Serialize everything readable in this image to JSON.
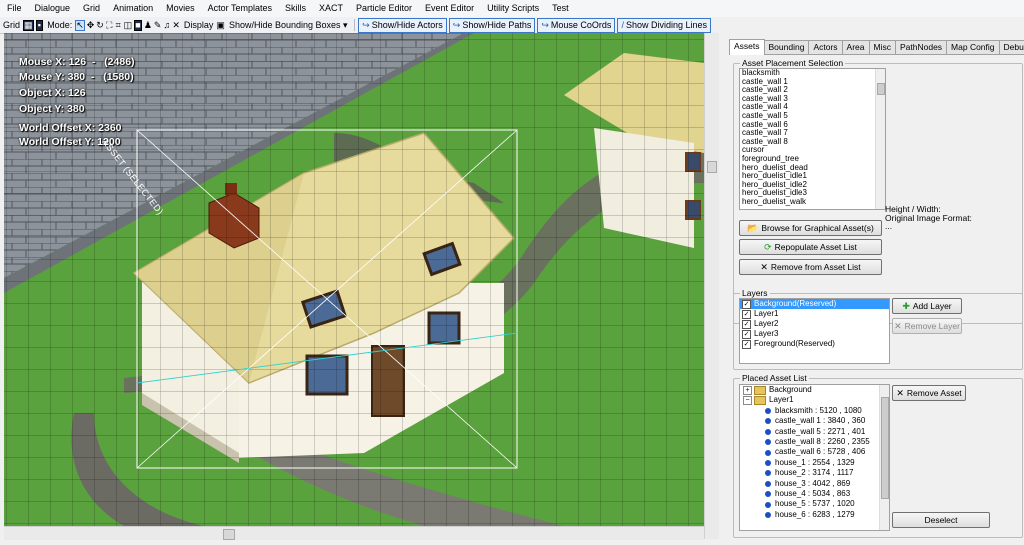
{
  "menu": [
    "File",
    "Dialogue",
    "Grid",
    "Animation",
    "Movies",
    "Actor Templates",
    "Skills",
    "XACT",
    "Particle Editor",
    "Event Editor",
    "Utility Scripts",
    "Test"
  ],
  "toolbar": {
    "grid_label": "Grid",
    "mode_label": "Mode:",
    "display_label": "Display",
    "show_bounding_boxes": "Show/Hide Bounding Boxes",
    "show_actors": "Show/Hide Actors",
    "show_paths": "Show/Hide Paths",
    "mouse_coords": "Mouse CoOrds",
    "dividing_lines": "Show Dividing Lines"
  },
  "hud": {
    "mouse_x": "Mouse X: 126  -   (2486)",
    "mouse_y": "Mouse Y: 380  -   (1580)",
    "object_x": "Object X: 126",
    "object_y": "Object Y: 380",
    "world_offset_x": "World Offset X: 2360",
    "world_offset_y": "World Offset Y: 1200",
    "selected_label": "ASSET (SELECTED)"
  },
  "tabs": [
    "Assets",
    "Bounding",
    "Actors",
    "Area",
    "Misc",
    "PathNodes",
    "Map Config",
    "Debug"
  ],
  "asset_selection": {
    "title": "Asset Placement Selection",
    "items": [
      "blacksmith",
      "castle_wall 1",
      "castle_wall 2",
      "castle_wall 3",
      "castle_wall 4",
      "castle_wall 5",
      "castle_wall 6",
      "castle_wall 7",
      "castle_wall 8",
      "cursor",
      "foreground_tree",
      "hero_duelist_dead",
      "hero_duelist_idle1",
      "hero_duelist_idle2",
      "hero_duelist_idle3",
      "hero_duelist_walk"
    ],
    "height_width": "Height / Width:",
    "original_format": "Original Image Format:",
    "ellipsis": "...",
    "browse_button": "Browse for Graphical Asset(s)",
    "repopulate_button": "Repopulate Asset List",
    "remove_button": "Remove from Asset List"
  },
  "layers": {
    "title": "Layers",
    "items": [
      {
        "label": "Background(Reserved)",
        "checked": "✓"
      },
      {
        "label": "Layer1",
        "checked": "✓"
      },
      {
        "label": "Layer2",
        "checked": "✓"
      },
      {
        "label": "Layer3",
        "checked": "✓"
      },
      {
        "label": "Foreground(Reserved)",
        "checked": "✓"
      }
    ],
    "add_button": "Add Layer",
    "remove_button": "Remove Layer"
  },
  "placed": {
    "title": "Placed Asset List",
    "background": "Background",
    "layer1": "Layer1",
    "items": [
      "blacksmith : 5120 , 1080",
      "castle_wall 1 : 3840 , 360",
      "castle_wall 5 : 2271 , 401",
      "castle_wall 8 : 2260 , 2355",
      "castle_wall 6 : 5728 , 406",
      "house_1 : 2554 , 1329",
      "house_2 : 3174 , 1117",
      "house_3 : 4042 , 869",
      "house_4 : 5034 , 863",
      "house_5 : 5737 , 1020",
      "house_6 : 6283 , 1279"
    ],
    "remove_button": "Remove Asset",
    "deselect_button": "Deselect"
  },
  "colors": {
    "grass": "#5aa23e",
    "path": "#6a6a62",
    "thatch": "#e4d89a",
    "wall": "#f4f1e4",
    "selection": "#3399ff"
  }
}
